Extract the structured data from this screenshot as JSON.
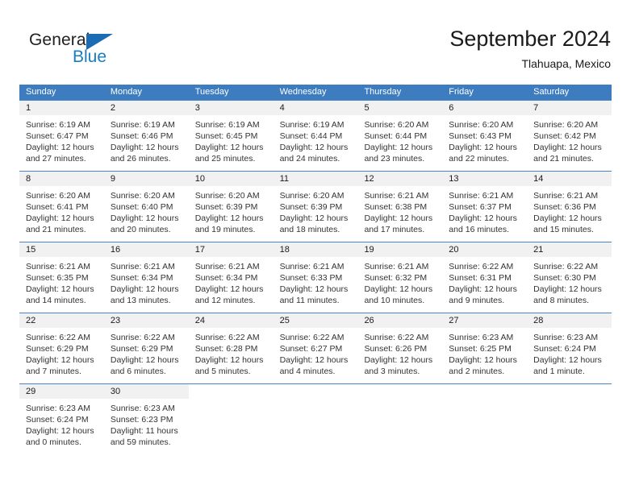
{
  "brand": {
    "name_top": "General",
    "name_bottom": "Blue",
    "triangle_color": "#1a6cb4",
    "blue_color": "#1a7cc1"
  },
  "header": {
    "title": "September 2024",
    "subtitle": "Tlahuapa, Mexico"
  },
  "theme": {
    "header_bg": "#3d7cbf",
    "header_text": "#ffffff",
    "daynum_bg": "#f1f1f1",
    "row_border": "#4a86c5",
    "body_text": "#333333"
  },
  "weekdays": [
    "Sunday",
    "Monday",
    "Tuesday",
    "Wednesday",
    "Thursday",
    "Friday",
    "Saturday"
  ],
  "weeks": [
    [
      {
        "day": "1",
        "sunrise": "Sunrise: 6:19 AM",
        "sunset": "Sunset: 6:47 PM",
        "daylight1": "Daylight: 12 hours",
        "daylight2": "and 27 minutes."
      },
      {
        "day": "2",
        "sunrise": "Sunrise: 6:19 AM",
        "sunset": "Sunset: 6:46 PM",
        "daylight1": "Daylight: 12 hours",
        "daylight2": "and 26 minutes."
      },
      {
        "day": "3",
        "sunrise": "Sunrise: 6:19 AM",
        "sunset": "Sunset: 6:45 PM",
        "daylight1": "Daylight: 12 hours",
        "daylight2": "and 25 minutes."
      },
      {
        "day": "4",
        "sunrise": "Sunrise: 6:19 AM",
        "sunset": "Sunset: 6:44 PM",
        "daylight1": "Daylight: 12 hours",
        "daylight2": "and 24 minutes."
      },
      {
        "day": "5",
        "sunrise": "Sunrise: 6:20 AM",
        "sunset": "Sunset: 6:44 PM",
        "daylight1": "Daylight: 12 hours",
        "daylight2": "and 23 minutes."
      },
      {
        "day": "6",
        "sunrise": "Sunrise: 6:20 AM",
        "sunset": "Sunset: 6:43 PM",
        "daylight1": "Daylight: 12 hours",
        "daylight2": "and 22 minutes."
      },
      {
        "day": "7",
        "sunrise": "Sunrise: 6:20 AM",
        "sunset": "Sunset: 6:42 PM",
        "daylight1": "Daylight: 12 hours",
        "daylight2": "and 21 minutes."
      }
    ],
    [
      {
        "day": "8",
        "sunrise": "Sunrise: 6:20 AM",
        "sunset": "Sunset: 6:41 PM",
        "daylight1": "Daylight: 12 hours",
        "daylight2": "and 21 minutes."
      },
      {
        "day": "9",
        "sunrise": "Sunrise: 6:20 AM",
        "sunset": "Sunset: 6:40 PM",
        "daylight1": "Daylight: 12 hours",
        "daylight2": "and 20 minutes."
      },
      {
        "day": "10",
        "sunrise": "Sunrise: 6:20 AM",
        "sunset": "Sunset: 6:39 PM",
        "daylight1": "Daylight: 12 hours",
        "daylight2": "and 19 minutes."
      },
      {
        "day": "11",
        "sunrise": "Sunrise: 6:20 AM",
        "sunset": "Sunset: 6:39 PM",
        "daylight1": "Daylight: 12 hours",
        "daylight2": "and 18 minutes."
      },
      {
        "day": "12",
        "sunrise": "Sunrise: 6:21 AM",
        "sunset": "Sunset: 6:38 PM",
        "daylight1": "Daylight: 12 hours",
        "daylight2": "and 17 minutes."
      },
      {
        "day": "13",
        "sunrise": "Sunrise: 6:21 AM",
        "sunset": "Sunset: 6:37 PM",
        "daylight1": "Daylight: 12 hours",
        "daylight2": "and 16 minutes."
      },
      {
        "day": "14",
        "sunrise": "Sunrise: 6:21 AM",
        "sunset": "Sunset: 6:36 PM",
        "daylight1": "Daylight: 12 hours",
        "daylight2": "and 15 minutes."
      }
    ],
    [
      {
        "day": "15",
        "sunrise": "Sunrise: 6:21 AM",
        "sunset": "Sunset: 6:35 PM",
        "daylight1": "Daylight: 12 hours",
        "daylight2": "and 14 minutes."
      },
      {
        "day": "16",
        "sunrise": "Sunrise: 6:21 AM",
        "sunset": "Sunset: 6:34 PM",
        "daylight1": "Daylight: 12 hours",
        "daylight2": "and 13 minutes."
      },
      {
        "day": "17",
        "sunrise": "Sunrise: 6:21 AM",
        "sunset": "Sunset: 6:34 PM",
        "daylight1": "Daylight: 12 hours",
        "daylight2": "and 12 minutes."
      },
      {
        "day": "18",
        "sunrise": "Sunrise: 6:21 AM",
        "sunset": "Sunset: 6:33 PM",
        "daylight1": "Daylight: 12 hours",
        "daylight2": "and 11 minutes."
      },
      {
        "day": "19",
        "sunrise": "Sunrise: 6:21 AM",
        "sunset": "Sunset: 6:32 PM",
        "daylight1": "Daylight: 12 hours",
        "daylight2": "and 10 minutes."
      },
      {
        "day": "20",
        "sunrise": "Sunrise: 6:22 AM",
        "sunset": "Sunset: 6:31 PM",
        "daylight1": "Daylight: 12 hours",
        "daylight2": "and 9 minutes."
      },
      {
        "day": "21",
        "sunrise": "Sunrise: 6:22 AM",
        "sunset": "Sunset: 6:30 PM",
        "daylight1": "Daylight: 12 hours",
        "daylight2": "and 8 minutes."
      }
    ],
    [
      {
        "day": "22",
        "sunrise": "Sunrise: 6:22 AM",
        "sunset": "Sunset: 6:29 PM",
        "daylight1": "Daylight: 12 hours",
        "daylight2": "and 7 minutes."
      },
      {
        "day": "23",
        "sunrise": "Sunrise: 6:22 AM",
        "sunset": "Sunset: 6:29 PM",
        "daylight1": "Daylight: 12 hours",
        "daylight2": "and 6 minutes."
      },
      {
        "day": "24",
        "sunrise": "Sunrise: 6:22 AM",
        "sunset": "Sunset: 6:28 PM",
        "daylight1": "Daylight: 12 hours",
        "daylight2": "and 5 minutes."
      },
      {
        "day": "25",
        "sunrise": "Sunrise: 6:22 AM",
        "sunset": "Sunset: 6:27 PM",
        "daylight1": "Daylight: 12 hours",
        "daylight2": "and 4 minutes."
      },
      {
        "day": "26",
        "sunrise": "Sunrise: 6:22 AM",
        "sunset": "Sunset: 6:26 PM",
        "daylight1": "Daylight: 12 hours",
        "daylight2": "and 3 minutes."
      },
      {
        "day": "27",
        "sunrise": "Sunrise: 6:23 AM",
        "sunset": "Sunset: 6:25 PM",
        "daylight1": "Daylight: 12 hours",
        "daylight2": "and 2 minutes."
      },
      {
        "day": "28",
        "sunrise": "Sunrise: 6:23 AM",
        "sunset": "Sunset: 6:24 PM",
        "daylight1": "Daylight: 12 hours",
        "daylight2": "and 1 minute."
      }
    ],
    [
      {
        "day": "29",
        "sunrise": "Sunrise: 6:23 AM",
        "sunset": "Sunset: 6:24 PM",
        "daylight1": "Daylight: 12 hours",
        "daylight2": "and 0 minutes."
      },
      {
        "day": "30",
        "sunrise": "Sunrise: 6:23 AM",
        "sunset": "Sunset: 6:23 PM",
        "daylight1": "Daylight: 11 hours",
        "daylight2": "and 59 minutes."
      },
      null,
      null,
      null,
      null,
      null
    ]
  ]
}
